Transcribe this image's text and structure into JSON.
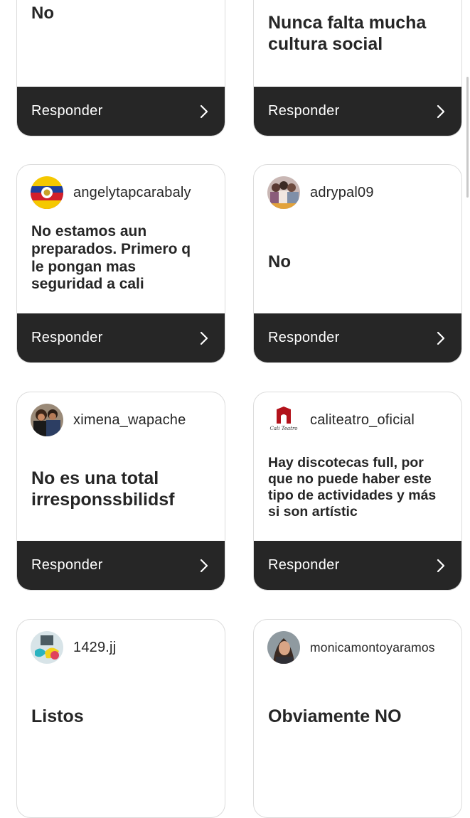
{
  "cards": [
    {
      "answer": "No",
      "reply_label": "Responder"
    },
    {
      "answer": "Nunca falta mucha cultura social",
      "reply_label": "Responder"
    },
    {
      "username": "angelytapcarabaly",
      "answer": "No estamos aun preparados. Primero q le pongan mas seguridad a cali",
      "reply_label": "Responder"
    },
    {
      "username": "adrypal09",
      "answer": "No",
      "reply_label": "Responder"
    },
    {
      "username": "ximena_wapache",
      "answer": "No es una total irresponssbilidsf",
      "reply_label": "Responder"
    },
    {
      "username": "caliteatro_oficial",
      "answer": "Hay discotecas full, por que no puede haber este tipo de actividades y más si son artístic",
      "reply_label": "Responder"
    },
    {
      "username": "1429.jj",
      "answer": "Listos"
    },
    {
      "username": "monicamontoyaramos",
      "answer": "Obviamente NO"
    }
  ],
  "caliteatro_logo_text": "Cali Teatro",
  "icons": {
    "reply_arrow": "chevron-right-icon"
  },
  "colors": {
    "reply_bar": "#262626",
    "card_border": "#dcdcdc",
    "text": "#262626"
  }
}
